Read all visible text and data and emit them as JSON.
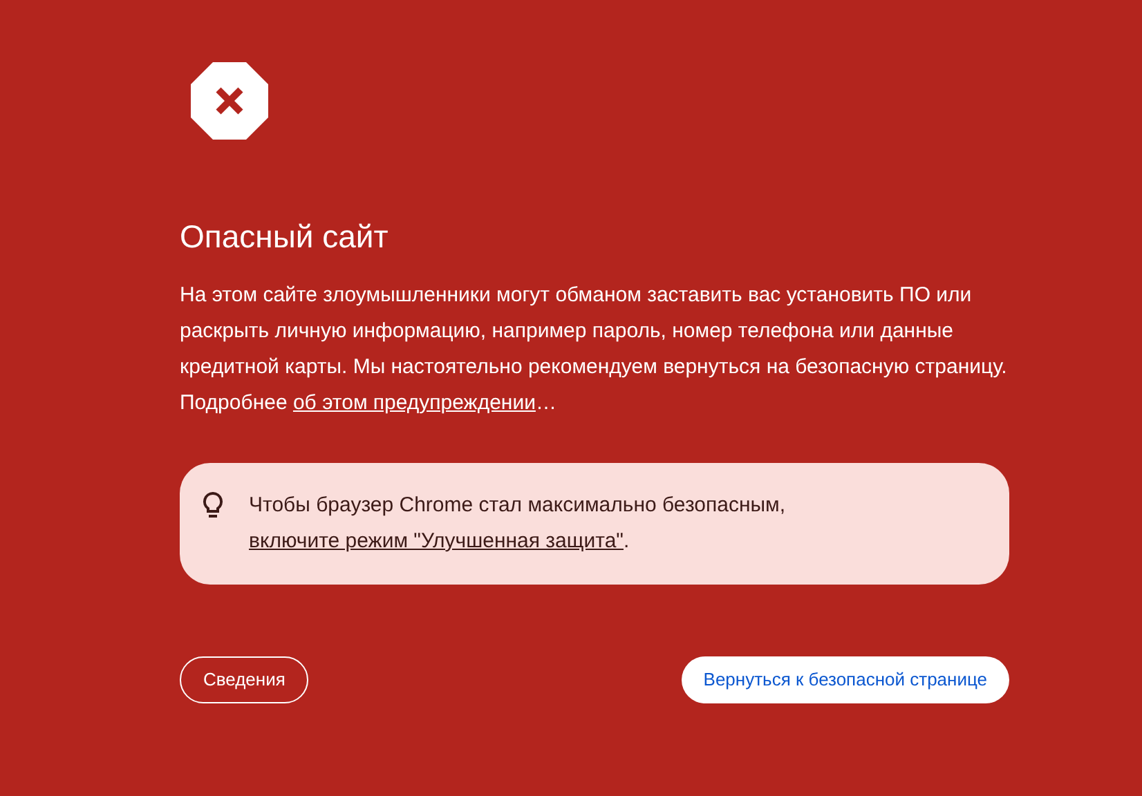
{
  "title": "Опасный сайт",
  "description": {
    "text": "На этом сайте злоумышленники могут обманом заставить вас установить ПО или раскрыть личную информацию, например пароль, номер телефона или данные кредитной карты. Мы настоятельно рекомендуем вернуться на безопасную страницу. Подробнее ",
    "link": "об этом предупреждении",
    "suffix": "…"
  },
  "tip": {
    "text": "Чтобы браузер Chrome стал максимально безопасным, ",
    "link": "включите режим \"Улучшенная защита\"",
    "suffix": "."
  },
  "buttons": [
    {
      "label": "Сведения",
      "kind": "outline"
    },
    {
      "label": "Вернуться к безопасной странице",
      "kind": "primary"
    }
  ]
}
